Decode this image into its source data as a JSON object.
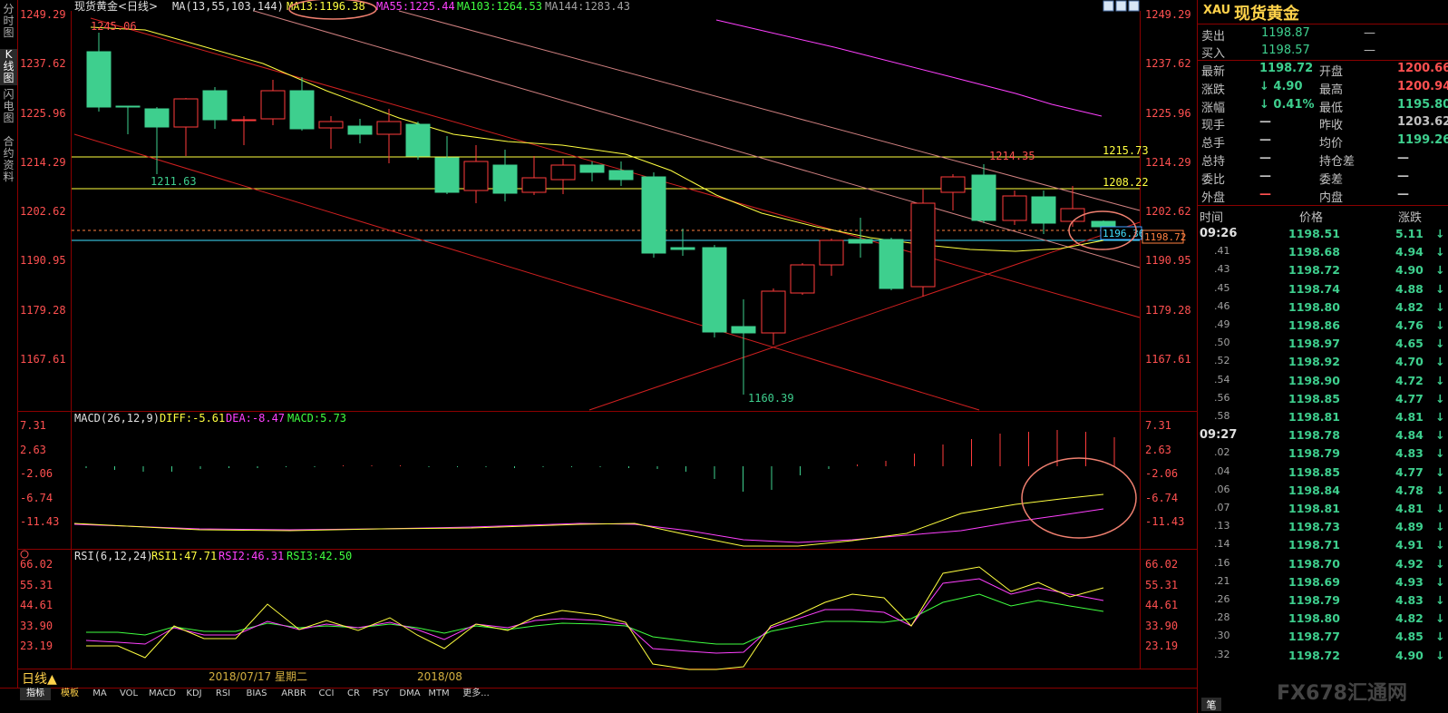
{
  "left_tabs": [
    "分时图",
    "K线图",
    "闪电图",
    "合约资料"
  ],
  "chart_header": {
    "title": "现货黄金<日线>",
    "ma_params": "MA(13,55,103,144)",
    "ma13": "MA13:1196.38",
    "ma55": "MA55:1225.44",
    "ma103": "MA103:1264.53",
    "ma144": "MA144:1283.43"
  },
  "price_axis_left": [
    "1249.29",
    "1237.62",
    "1225.96",
    "1214.29",
    "1202.62",
    "1190.95",
    "1179.28",
    "1167.61"
  ],
  "price_axis_right": [
    "1249.29",
    "1237.62",
    "1225.96",
    "1214.29",
    "1202.62",
    "1190.95",
    "1179.28",
    "1167.61"
  ],
  "price_annotations": {
    "high_label": "1245.06",
    "low_label_left": "1211.63",
    "low_label": "1160.39",
    "recent_high": "1214.35",
    "line_1215": "1215.73",
    "line_1208": "1208.22",
    "ma_mark": "1196.36",
    "last_price": "1198.72"
  },
  "macd_header": {
    "params": "MACD(26,12,9)",
    "diff": "DIFF:-5.61",
    "dea": "DEA:-8.47",
    "macd": "MACD:5.73"
  },
  "macd_axis": [
    "7.31",
    "2.63",
    "-2.06",
    "-6.74",
    "-11.43"
  ],
  "rsi_header": {
    "params": "RSI(6,12,24)",
    "rsi1": "RSI1:47.71",
    "rsi2": "RSI2:46.31",
    "rsi3": "RSI3:42.50"
  },
  "rsi_axis": [
    "66.02",
    "55.31",
    "44.61",
    "33.90",
    "23.19"
  ],
  "date_axis": {
    "period": "日线",
    "date1": "2018/07/17 星期二",
    "date2": "2018/08"
  },
  "indicator_tabs": [
    "指标",
    "模板",
    "MA",
    "VOL",
    "MACD",
    "KDJ",
    "RSI",
    "BIAS",
    "ARBR",
    "CCI",
    "CR",
    "PSY",
    "DMA",
    "MTM",
    "更多..."
  ],
  "panel": {
    "symbol": "XAU",
    "name": "现货黄金",
    "sell_label": "卖出",
    "sell": "1198.87",
    "sell_vol": "—",
    "buy_label": "买入",
    "buy": "1198.57",
    "buy_vol": "—",
    "quotes": [
      {
        "l1": "最新",
        "v1": "1198.72",
        "l2": "开盘",
        "v2": "1200.66"
      },
      {
        "l1": "涨跌",
        "v1": "↓ 4.90",
        "l2": "最高",
        "v2": "1200.94"
      },
      {
        "l1": "涨幅",
        "v1": "↓ 0.41%",
        "l2": "最低",
        "v2": "1195.80"
      },
      {
        "l1": "现手",
        "v1": "—",
        "l2": "昨收",
        "v2": "1203.62"
      },
      {
        "l1": "总手",
        "v1": "—",
        "l2": "均价",
        "v2": "1199.26"
      },
      {
        "l1": "总持",
        "v1": "—",
        "l2": "持仓差",
        "v2": "—"
      },
      {
        "l1": "委比",
        "v1": "—",
        "l2": "委差",
        "v2": "—"
      },
      {
        "l1": "外盘",
        "v1": "—",
        "l2": "内盘",
        "v2": "—"
      }
    ],
    "ticks_header": {
      "time": "时间",
      "price": "价格",
      "change": "涨跌"
    },
    "ticks": [
      {
        "t": "09:26",
        "p": "1198.51",
        "c": "5.11"
      },
      {
        "t": ".41",
        "p": "1198.68",
        "c": "4.94"
      },
      {
        "t": ".43",
        "p": "1198.72",
        "c": "4.90"
      },
      {
        "t": ".45",
        "p": "1198.74",
        "c": "4.88"
      },
      {
        "t": ".46",
        "p": "1198.80",
        "c": "4.82"
      },
      {
        "t": ".49",
        "p": "1198.86",
        "c": "4.76"
      },
      {
        "t": ".50",
        "p": "1198.97",
        "c": "4.65"
      },
      {
        "t": ".52",
        "p": "1198.92",
        "c": "4.70"
      },
      {
        "t": ".54",
        "p": "1198.90",
        "c": "4.72"
      },
      {
        "t": ".56",
        "p": "1198.85",
        "c": "4.77"
      },
      {
        "t": ".58",
        "p": "1198.81",
        "c": "4.81"
      },
      {
        "t": "09:27",
        "p": "1198.78",
        "c": "4.84"
      },
      {
        "t": ".02",
        "p": "1198.79",
        "c": "4.83"
      },
      {
        "t": ".04",
        "p": "1198.85",
        "c": "4.77"
      },
      {
        "t": ".06",
        "p": "1198.84",
        "c": "4.78"
      },
      {
        "t": ".07",
        "p": "1198.81",
        "c": "4.81"
      },
      {
        "t": ".13",
        "p": "1198.73",
        "c": "4.89"
      },
      {
        "t": ".14",
        "p": "1198.71",
        "c": "4.91"
      },
      {
        "t": ".16",
        "p": "1198.70",
        "c": "4.92"
      },
      {
        "t": ".21",
        "p": "1198.69",
        "c": "4.93"
      },
      {
        "t": ".26",
        "p": "1198.79",
        "c": "4.83"
      },
      {
        "t": ".28",
        "p": "1198.80",
        "c": "4.82"
      },
      {
        "t": ".30",
        "p": "1198.77",
        "c": "4.85"
      },
      {
        "t": ".32",
        "p": "1198.72",
        "c": "4.90"
      }
    ],
    "bottom_tab": "笔",
    "watermark": "FX678汇通网"
  },
  "colors": {
    "up": "#ff3b3b",
    "down": "#3ecf8e",
    "ma13": "#ffff40",
    "ma55": "#ff40ff",
    "ma103": "#40ff40",
    "ma144": "#a0a0a0",
    "grid": "#8b0000",
    "axis_text": "#ff5050"
  }
}
